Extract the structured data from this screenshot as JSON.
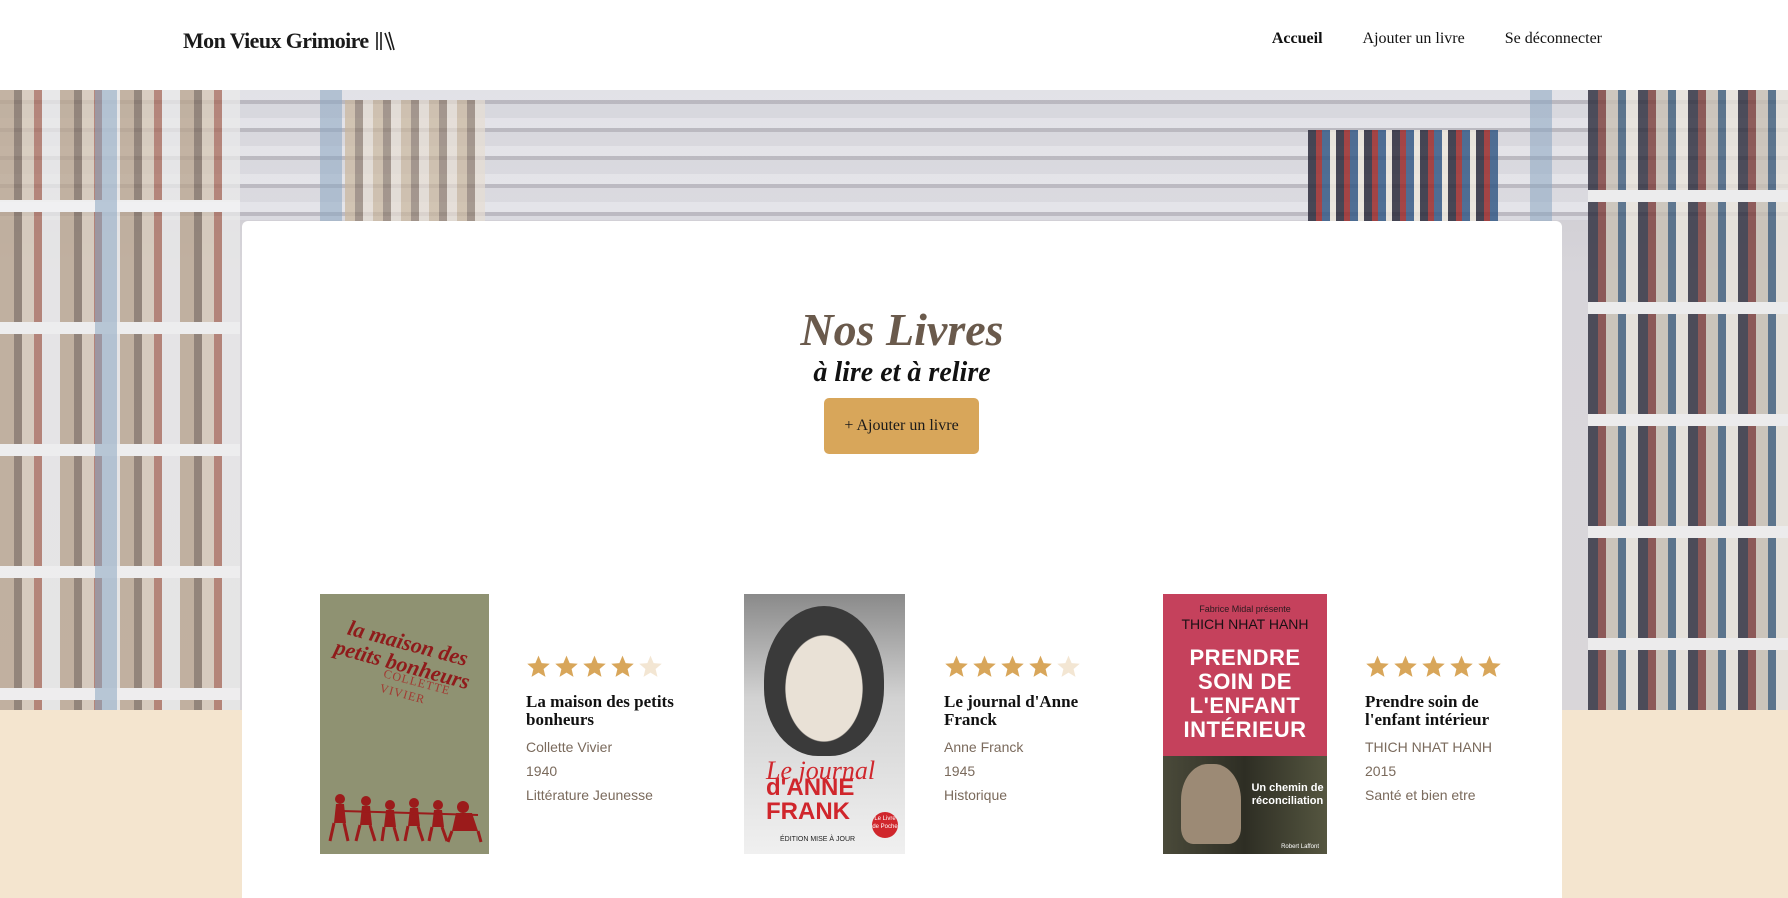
{
  "header": {
    "logo_text": "Mon Vieux Grimoire",
    "nav": [
      {
        "label": "Accueil",
        "active": true
      },
      {
        "label": "Ajouter un livre",
        "active": false
      },
      {
        "label": "Se déconnecter",
        "active": false
      }
    ]
  },
  "main": {
    "title": "Nos Livres",
    "subtitle": "à lire et à relire",
    "add_button": "+ Ajouter un livre"
  },
  "books": [
    {
      "title": "La maison des petits bonheurs",
      "author": "Collette Vivier",
      "year": "1940",
      "genre": "Littérature Jeunesse",
      "rating": 4,
      "cover_text": {
        "title": "la maison des petits bonheurs",
        "author": "COLLETTE VIVIER"
      }
    },
    {
      "title": "Le journal d'Anne Franck",
      "author": "Anne Franck",
      "year": "1945",
      "genre": "Historique",
      "rating": 4,
      "cover_text": {
        "script": "Le journal",
        "name": "d'ANNE FRANK",
        "edition": "ÉDITION MISE À JOUR",
        "seal": "Le Livre de Poche"
      }
    },
    {
      "title": "Prendre soin de l'enfant intérieur",
      "author": "THICH NHAT HANH",
      "year": "2015",
      "genre": "Santé et bien etre",
      "rating": 5,
      "cover_text": {
        "presents": "Fabrice Midal présente",
        "author": "THICH NHAT HANH",
        "main": "PRENDRE SOIN DE L'ENFANT INTÉRIEUR",
        "sub": "Un chemin de réconciliation",
        "publisher": "Robert Laffont"
      }
    }
  ],
  "colors": {
    "accent": "#d8a65a",
    "star_filled": "#d8a65a",
    "star_empty": "#f3e6d3",
    "footer_bg": "#f4e5cf",
    "title_color": "#6a5a4c"
  }
}
